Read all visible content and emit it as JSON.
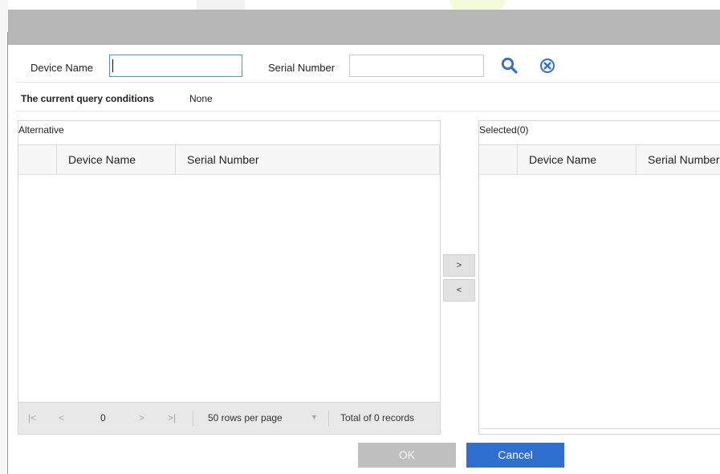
{
  "query": {
    "device_name_label": "Device Name",
    "device_name_value": "",
    "serial_number_label": "Serial Number",
    "serial_number_value": "",
    "current_conditions_label": "The current query conditions",
    "current_conditions_value": "None"
  },
  "alternative": {
    "title": "Alternative",
    "columns": [
      "Device Name",
      "Serial Number"
    ],
    "rows": [],
    "pager": {
      "first": "|<",
      "prev": "<",
      "page": "0",
      "next": ">",
      "last": ">|",
      "rows_per_page": "50 rows per page",
      "total": "Total of 0 records"
    }
  },
  "transfer": {
    "add": ">",
    "remove": "<"
  },
  "selected": {
    "title": "Selected(0)",
    "columns": [
      "Device Name",
      "Serial Number"
    ],
    "rows": []
  },
  "footer": {
    "ok": "OK",
    "cancel": "Cancel"
  },
  "colors": {
    "accent": "#2e6fd0",
    "titlebar": "#b7b7b7",
    "search_icon": "#2e6fd0"
  },
  "icons": {
    "search": "search-icon",
    "clear": "clear-icon",
    "dropdown": "caret-down-icon"
  }
}
